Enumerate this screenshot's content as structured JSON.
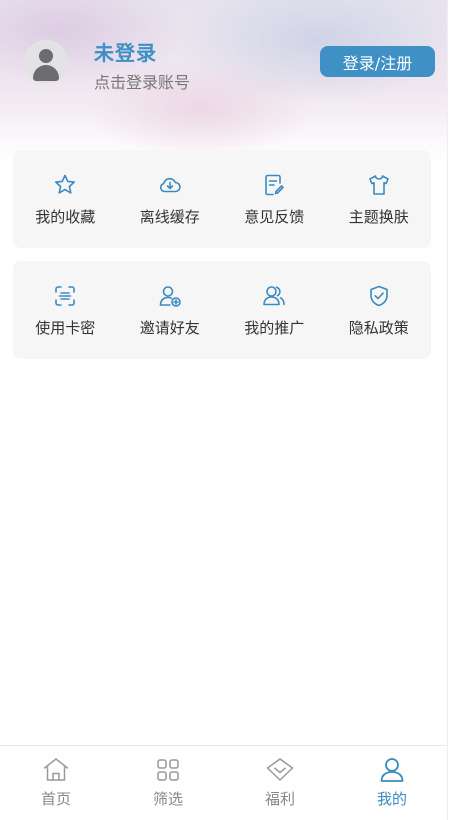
{
  "profile": {
    "name": "未登录",
    "subtitle": "点击登录账号",
    "login_button": "登录/注册"
  },
  "colors": {
    "accent": "#3f90c5",
    "icon": "#3a8bc0",
    "card_bg": "#f6f6f7"
  },
  "menu_group_1": [
    {
      "label": "我的收藏",
      "icon": "star-icon"
    },
    {
      "label": "离线缓存",
      "icon": "cloud-download-icon"
    },
    {
      "label": "意见反馈",
      "icon": "feedback-edit-icon"
    },
    {
      "label": "主题换肤",
      "icon": "tshirt-icon"
    }
  ],
  "menu_group_2": [
    {
      "label": "使用卡密",
      "icon": "card-scan-icon"
    },
    {
      "label": "邀请好友",
      "icon": "add-friend-icon"
    },
    {
      "label": "我的推广",
      "icon": "users-icon"
    },
    {
      "label": "隐私政策",
      "icon": "shield-check-icon"
    }
  ],
  "tabbar": [
    {
      "label": "首页",
      "icon": "home-icon",
      "active": false
    },
    {
      "label": "筛选",
      "icon": "grid-icon",
      "active": false
    },
    {
      "label": "福利",
      "icon": "diamond-icon",
      "active": false
    },
    {
      "label": "我的",
      "icon": "user-icon",
      "active": true
    }
  ]
}
